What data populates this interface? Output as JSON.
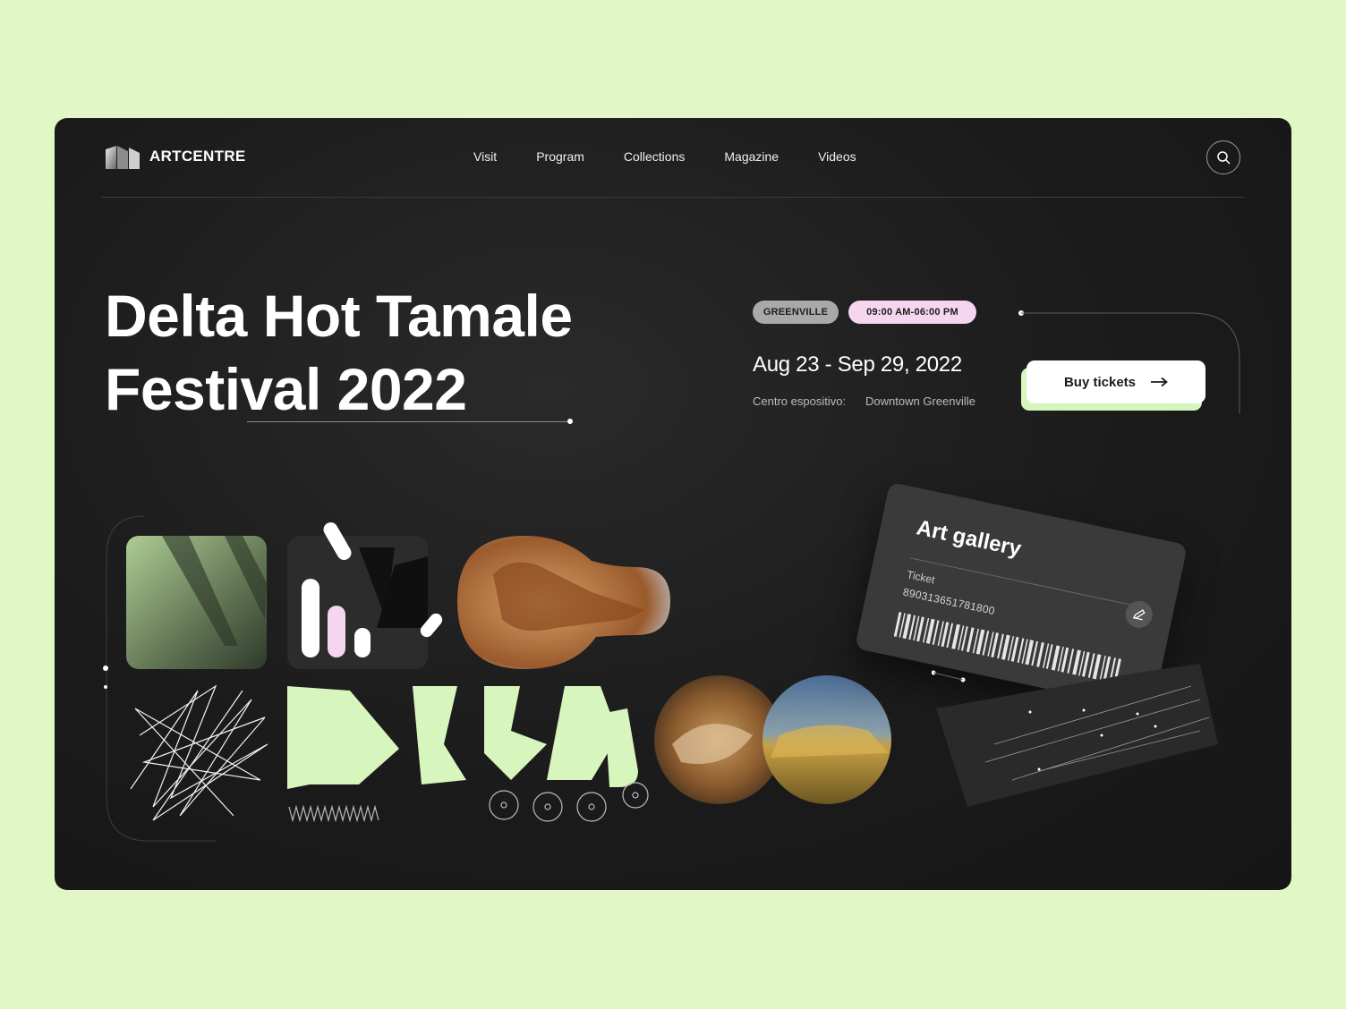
{
  "header": {
    "brand": "ARTCENTRE",
    "nav": [
      "Visit",
      "Program",
      "Collections",
      "Magazine",
      "Videos"
    ]
  },
  "hero": {
    "title_line1": "Delta Hot Tamale",
    "title_line2": "Festival 2022"
  },
  "event": {
    "city_badge": "GREENVILLE",
    "time_badge": "09:00 AM-06:00 PM",
    "dates": "Aug 23 - Sep 29, 2022",
    "venue_label": "Centro espositivo:",
    "venue": "Downtown Greenville",
    "cta": "Buy tickets"
  },
  "ticket": {
    "title": "Art gallery",
    "label": "Ticket",
    "number": "890313651781800"
  },
  "colors": {
    "background": "#e2f7c6",
    "card": "#1b1b1b",
    "accent_green": "#d7f6bd",
    "accent_pink": "#f6d6ee"
  },
  "icons": [
    "logo-icon",
    "search-icon",
    "arrow-right-icon",
    "edit-icon"
  ]
}
